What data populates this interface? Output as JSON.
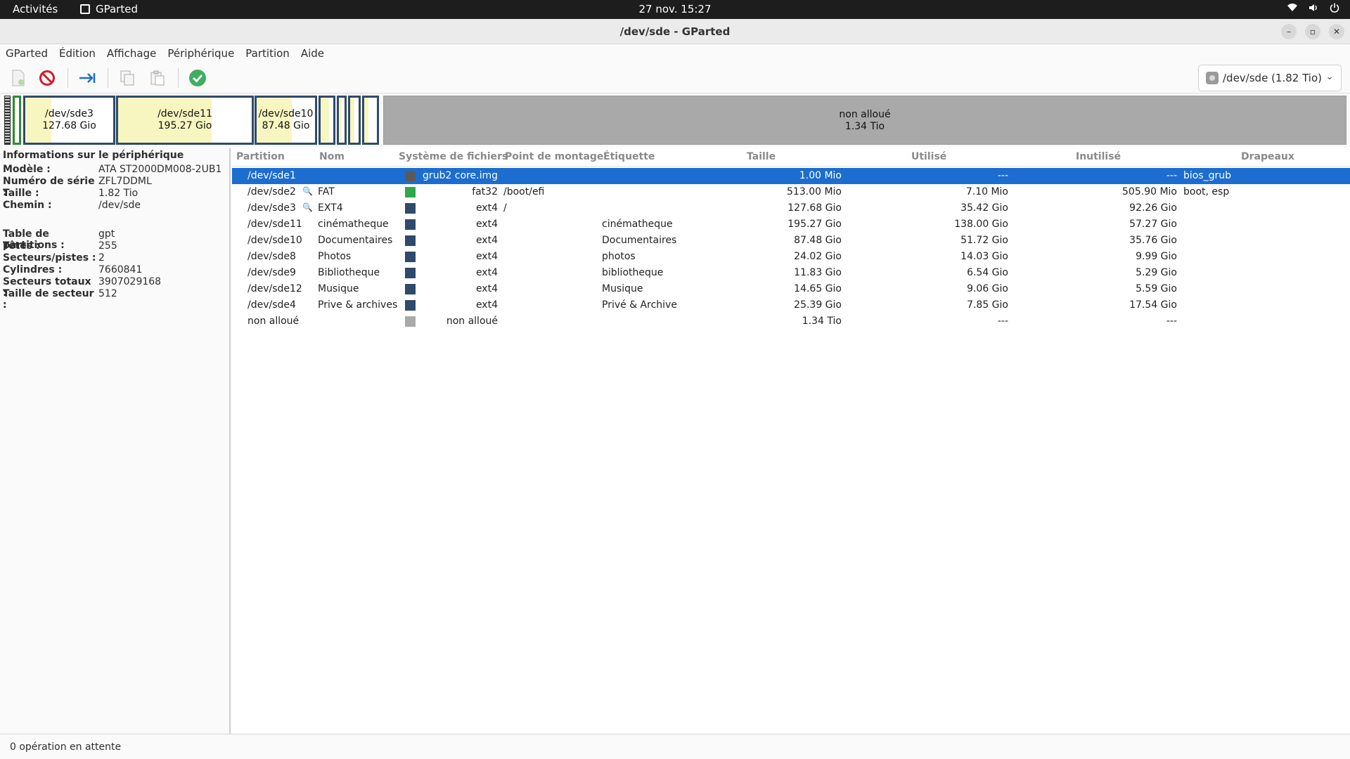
{
  "topbar": {
    "activities": "Activités",
    "app_name": "GParted",
    "clock": "27 nov.  15:27",
    "tray": [
      "wifi-icon",
      "volume-icon",
      "power-icon"
    ]
  },
  "window": {
    "title": "/dev/sde - GParted"
  },
  "menu": [
    "GParted",
    "Édition",
    "Affichage",
    "Périphérique",
    "Partition",
    "Aide"
  ],
  "toolbar": {
    "buttons": [
      "new-partition-icon",
      "delete-icon",
      "resize-move-icon",
      "copy-icon",
      "paste-icon",
      "apply-icon"
    ],
    "device_selector": "/dev/sde (1.82 Tio)"
  },
  "diskmap": {
    "segments": [
      {
        "name": "/dev/sde3",
        "size": "127.68 Gio"
      },
      {
        "name": "/dev/sde11",
        "size": "195.27 Gio"
      },
      {
        "name": "/dev/sde10",
        "size": "87.48 Gio"
      },
      {
        "name": "non alloué",
        "size": "1.34 Tio"
      }
    ]
  },
  "device_info": {
    "title": "Informations sur le périphérique",
    "rows1": [
      {
        "label": "Modèle :",
        "value": "ATA ST2000DM008-2UB1"
      },
      {
        "label": "Numéro de série :",
        "value": "ZFL7DDML"
      },
      {
        "label": "Taille :",
        "value": "1.82 Tio"
      },
      {
        "label": "Chemin :",
        "value": "/dev/sde"
      }
    ],
    "rows2": [
      {
        "label": "Table de partitions :",
        "value": "gpt"
      },
      {
        "label": "Têtes :",
        "value": "255"
      },
      {
        "label": "Secteurs/pistes :",
        "value": "2"
      },
      {
        "label": "Cylindres :",
        "value": "7660841"
      },
      {
        "label": "Secteurs totaux :",
        "value": "3907029168"
      },
      {
        "label": "Taille de secteur :",
        "value": "512"
      }
    ]
  },
  "table": {
    "headers": [
      "Partition",
      "Nom",
      "Système de fichiers",
      "Point de montage",
      "Étiquette",
      "Taille",
      "Utilisé",
      "Inutilisé",
      "Drapeaux"
    ],
    "rows": [
      {
        "partition": "/dev/sde1",
        "name": "",
        "fs": "grub2 core.img",
        "mount": "",
        "label": "",
        "size": "1.00 Mio",
        "used": "---",
        "unused": "---",
        "flags": "bios_grub",
        "color": "#5a5a5a",
        "selected": true,
        "key": false
      },
      {
        "partition": "/dev/sde2",
        "name": "FAT",
        "fs": "fat32",
        "mount": "/boot/efi",
        "label": "",
        "size": "513.00 Mio",
        "used": "7.10 Mio",
        "unused": "505.90 Mio",
        "flags": "boot, esp",
        "color": "#2fa84a",
        "selected": false,
        "key": true
      },
      {
        "partition": "/dev/sde3",
        "name": "EXT4",
        "fs": "ext4",
        "mount": "/",
        "label": "",
        "size": "127.68 Gio",
        "used": "35.42 Gio",
        "unused": "92.26 Gio",
        "flags": "",
        "color": "#2f4a6b",
        "selected": false,
        "key": true
      },
      {
        "partition": "/dev/sde11",
        "name": "cinématheque",
        "fs": "ext4",
        "mount": "",
        "label": "cinématheque",
        "size": "195.27 Gio",
        "used": "138.00 Gio",
        "unused": "57.27 Gio",
        "flags": "",
        "color": "#2f4a6b",
        "selected": false,
        "key": false
      },
      {
        "partition": "/dev/sde10",
        "name": "Documentaires",
        "fs": "ext4",
        "mount": "",
        "label": "Documentaires",
        "size": "87.48 Gio",
        "used": "51.72 Gio",
        "unused": "35.76 Gio",
        "flags": "",
        "color": "#2f4a6b",
        "selected": false,
        "key": false
      },
      {
        "partition": "/dev/sde8",
        "name": "Photos",
        "fs": "ext4",
        "mount": "",
        "label": "photos",
        "size": "24.02 Gio",
        "used": "14.03 Gio",
        "unused": "9.99 Gio",
        "flags": "",
        "color": "#2f4a6b",
        "selected": false,
        "key": false
      },
      {
        "partition": "/dev/sde9",
        "name": "Bibliotheque",
        "fs": "ext4",
        "mount": "",
        "label": "bibliotheque",
        "size": "11.83 Gio",
        "used": "6.54 Gio",
        "unused": "5.29 Gio",
        "flags": "",
        "color": "#2f4a6b",
        "selected": false,
        "key": false
      },
      {
        "partition": "/dev/sde12",
        "name": "Musique",
        "fs": "ext4",
        "mount": "",
        "label": "Musique",
        "size": "14.65 Gio",
        "used": "9.06 Gio",
        "unused": "5.59 Gio",
        "flags": "",
        "color": "#2f4a6b",
        "selected": false,
        "key": false
      },
      {
        "partition": "/dev/sde4",
        "name": "Prive & archives",
        "fs": "ext4",
        "mount": "",
        "label": "Privé & Archive",
        "size": "25.39 Gio",
        "used": "7.85 Gio",
        "unused": "17.54 Gio",
        "flags": "",
        "color": "#2f4a6b",
        "selected": false,
        "key": false
      },
      {
        "partition": "non alloué",
        "name": "",
        "fs": "non alloué",
        "mount": "",
        "label": "",
        "size": "1.34 Tio",
        "used": "---",
        "unused": "---",
        "flags": "",
        "color": "#a9a9a9",
        "selected": false,
        "key": false
      }
    ]
  },
  "status": {
    "text": "0 opération en attente"
  }
}
